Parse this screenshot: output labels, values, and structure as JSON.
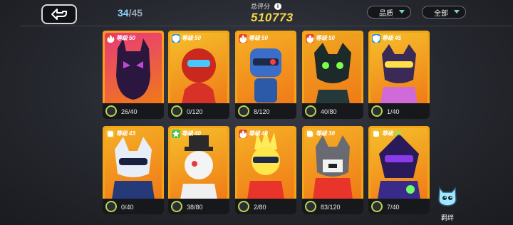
{
  "header": {
    "count_current": "34",
    "count_separator": "/",
    "count_total": "45",
    "score_label": "总评分",
    "score_value": "510773",
    "info_icon": "i",
    "filter_quality": "品质",
    "filter_all": "全部"
  },
  "bond_label": "羁绊",
  "colors": {
    "accent_score": "#f5d84a",
    "count_current": "#8fd3ff",
    "card_frame": "#f2a516"
  },
  "cards": [
    {
      "level_label": "等级",
      "level": "50",
      "progress": "26/40",
      "icon": "fire-icon",
      "tag_color": "#e8432a",
      "art_bg": "#e83a7a",
      "frame": "#ff9a1f"
    },
    {
      "level_label": "等级",
      "level": "50",
      "progress": "0/120",
      "icon": "shield-icon",
      "tag_color": "#2a8fe8",
      "art_bg": "#f5c02a",
      "frame": "#f2a516"
    },
    {
      "level_label": "等级",
      "level": "50",
      "progress": "8/120",
      "icon": "fire-icon",
      "tag_color": "#e8432a",
      "art_bg": "#f5b025",
      "frame": "#f2a516"
    },
    {
      "level_label": "等级",
      "level": "50",
      "progress": "40/80",
      "icon": "fire-icon",
      "tag_color": "#e8432a",
      "art_bg": "#f0a820",
      "frame": "#f2a516"
    },
    {
      "level_label": "等级",
      "level": "45",
      "progress": "1/40",
      "icon": "shield-icon",
      "tag_color": "#2a8fe8",
      "art_bg": "#f5c02a",
      "frame": "#f2a516"
    },
    {
      "level_label": "等级",
      "level": "43",
      "progress": "0/40",
      "icon": "fist-icon",
      "tag_color": "#f0b82a",
      "art_bg": "#f5b025",
      "frame": "#f2a516"
    },
    {
      "level_label": "等级",
      "level": "40",
      "progress": "38/80",
      "icon": "star-icon",
      "tag_color": "#4ec04e",
      "art_bg": "#f5c02a",
      "frame": "#f2a516"
    },
    {
      "level_label": "等级",
      "level": "40",
      "progress": "2/80",
      "icon": "fire-icon",
      "tag_color": "#e8432a",
      "art_bg": "#f5b025",
      "frame": "#f2a516"
    },
    {
      "level_label": "等级",
      "level": "30",
      "progress": "83/120",
      "icon": "fist-icon",
      "tag_color": "#f0b82a",
      "art_bg": "#f5b025",
      "frame": "#f2a516"
    },
    {
      "level_label": "等级",
      "level": "45",
      "progress": "7/40",
      "icon": "fist-icon",
      "tag_color": "#f0b82a",
      "art_bg": "#f5c02a",
      "frame": "#f2a516",
      "level_green": true
    }
  ]
}
